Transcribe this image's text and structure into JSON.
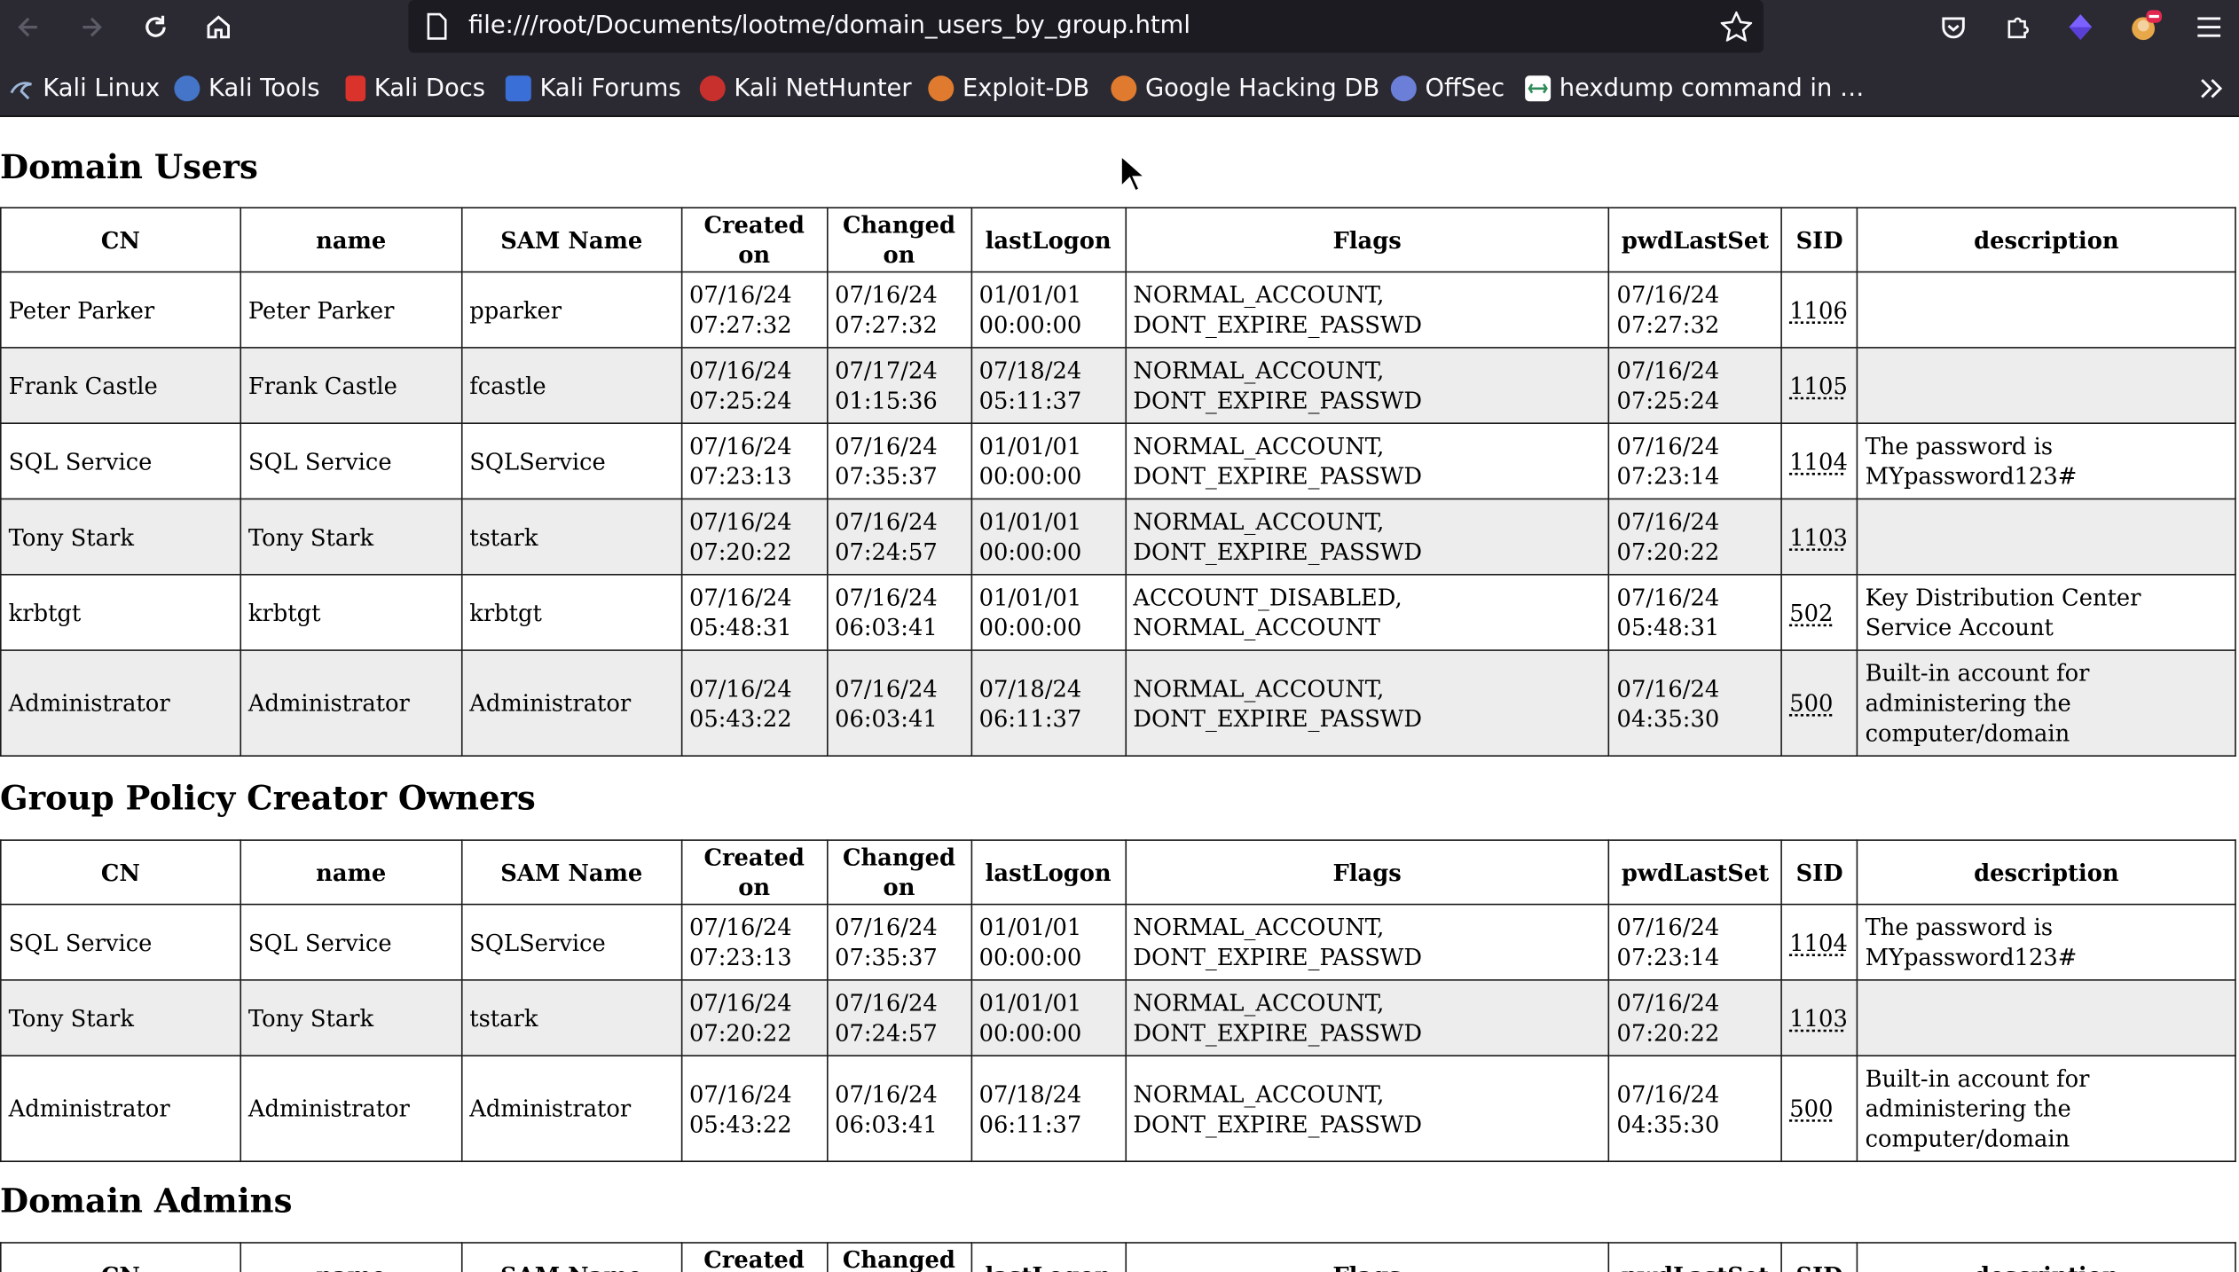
{
  "browser": {
    "url": "file:///root/Documents/lootme/domain_users_by_group.html",
    "bookmarks": [
      {
        "label": "Kali Linux",
        "icon": "kali-dragon-icon"
      },
      {
        "label": "Kali Tools",
        "icon": "kali-tools-icon"
      },
      {
        "label": "Kali Docs",
        "icon": "kali-docs-icon"
      },
      {
        "label": "Kali Forums",
        "icon": "kali-forums-icon"
      },
      {
        "label": "Kali NetHunter",
        "icon": "nethunter-icon"
      },
      {
        "label": "Exploit-DB",
        "icon": "exploit-db-icon"
      },
      {
        "label": "Google Hacking DB",
        "icon": "ghdb-icon"
      },
      {
        "label": "OffSec",
        "icon": "offsec-icon"
      },
      {
        "label": "hexdump command in …",
        "icon": "hexdump-icon"
      }
    ]
  },
  "headers": [
    "CN",
    "name",
    "SAM Name",
    "Created on",
    "Changed on",
    "lastLogon",
    "Flags",
    "pwdLastSet",
    "SID",
    "description"
  ],
  "sections": [
    {
      "title": "Domain Users",
      "rows": [
        {
          "cn": "Peter Parker",
          "name": "Peter Parker",
          "sam": "pparker",
          "created_date": "07/16/24",
          "created_time": "07:27:32",
          "changed_date": "07/16/24",
          "changed_time": "07:27:32",
          "logon_date": "01/01/01",
          "logon_time": "00:00:00",
          "flags1": "NORMAL_ACCOUNT,",
          "flags2": "DONT_EXPIRE_PASSWD",
          "pwd_date": "07/16/24",
          "pwd_time": "07:27:32",
          "sid": "1106",
          "desc1": "",
          "desc2": "",
          "desc3": ""
        },
        {
          "cn": "Frank Castle",
          "name": "Frank Castle",
          "sam": "fcastle",
          "created_date": "07/16/24",
          "created_time": "07:25:24",
          "changed_date": "07/17/24",
          "changed_time": "01:15:36",
          "logon_date": "07/18/24",
          "logon_time": "05:11:37",
          "flags1": "NORMAL_ACCOUNT,",
          "flags2": "DONT_EXPIRE_PASSWD",
          "pwd_date": "07/16/24",
          "pwd_time": "07:25:24",
          "sid": "1105",
          "desc1": "",
          "desc2": "",
          "desc3": ""
        },
        {
          "cn": "SQL Service",
          "name": "SQL Service",
          "sam": "SQLService",
          "created_date": "07/16/24",
          "created_time": "07:23:13",
          "changed_date": "07/16/24",
          "changed_time": "07:35:37",
          "logon_date": "01/01/01",
          "logon_time": "00:00:00",
          "flags1": "NORMAL_ACCOUNT,",
          "flags2": "DONT_EXPIRE_PASSWD",
          "pwd_date": "07/16/24",
          "pwd_time": "07:23:14",
          "sid": "1104",
          "desc1": "The password is",
          "desc2": "MYpassword123#",
          "desc3": ""
        },
        {
          "cn": "Tony Stark",
          "name": "Tony Stark",
          "sam": "tstark",
          "created_date": "07/16/24",
          "created_time": "07:20:22",
          "changed_date": "07/16/24",
          "changed_time": "07:24:57",
          "logon_date": "01/01/01",
          "logon_time": "00:00:00",
          "flags1": "NORMAL_ACCOUNT,",
          "flags2": "DONT_EXPIRE_PASSWD",
          "pwd_date": "07/16/24",
          "pwd_time": "07:20:22",
          "sid": "1103",
          "desc1": "",
          "desc2": "",
          "desc3": ""
        },
        {
          "cn": "krbtgt",
          "name": "krbtgt",
          "sam": "krbtgt",
          "created_date": "07/16/24",
          "created_time": "05:48:31",
          "changed_date": "07/16/24",
          "changed_time": "06:03:41",
          "logon_date": "01/01/01",
          "logon_time": "00:00:00",
          "flags1": "ACCOUNT_DISABLED,",
          "flags2": "NORMAL_ACCOUNT",
          "pwd_date": "07/16/24",
          "pwd_time": "05:48:31",
          "sid": "502",
          "desc1": "Key Distribution Center",
          "desc2": "Service Account",
          "desc3": ""
        },
        {
          "cn": "Administrator",
          "name": "Administrator",
          "sam": "Administrator",
          "created_date": "07/16/24",
          "created_time": "05:43:22",
          "changed_date": "07/16/24",
          "changed_time": "06:03:41",
          "logon_date": "07/18/24",
          "logon_time": "06:11:37",
          "flags1": "NORMAL_ACCOUNT,",
          "flags2": "DONT_EXPIRE_PASSWD",
          "pwd_date": "07/16/24",
          "pwd_time": "04:35:30",
          "sid": "500",
          "desc1": "Built-in account for",
          "desc2": "administering the",
          "desc3": "computer/domain"
        }
      ]
    },
    {
      "title": "Group Policy Creator Owners",
      "rows": [
        {
          "cn": "SQL Service",
          "name": "SQL Service",
          "sam": "SQLService",
          "created_date": "07/16/24",
          "created_time": "07:23:13",
          "changed_date": "07/16/24",
          "changed_time": "07:35:37",
          "logon_date": "01/01/01",
          "logon_time": "00:00:00",
          "flags1": "NORMAL_ACCOUNT,",
          "flags2": "DONT_EXPIRE_PASSWD",
          "pwd_date": "07/16/24",
          "pwd_time": "07:23:14",
          "sid": "1104",
          "desc1": "The password is",
          "desc2": "MYpassword123#",
          "desc3": ""
        },
        {
          "cn": "Tony Stark",
          "name": "Tony Stark",
          "sam": "tstark",
          "created_date": "07/16/24",
          "created_time": "07:20:22",
          "changed_date": "07/16/24",
          "changed_time": "07:24:57",
          "logon_date": "01/01/01",
          "logon_time": "00:00:00",
          "flags1": "NORMAL_ACCOUNT,",
          "flags2": "DONT_EXPIRE_PASSWD",
          "pwd_date": "07/16/24",
          "pwd_time": "07:20:22",
          "sid": "1103",
          "desc1": "",
          "desc2": "",
          "desc3": ""
        },
        {
          "cn": "Administrator",
          "name": "Administrator",
          "sam": "Administrator",
          "created_date": "07/16/24",
          "created_time": "05:43:22",
          "changed_date": "07/16/24",
          "changed_time": "06:03:41",
          "logon_date": "07/18/24",
          "logon_time": "06:11:37",
          "flags1": "NORMAL_ACCOUNT,",
          "flags2": "DONT_EXPIRE_PASSWD",
          "pwd_date": "07/16/24",
          "pwd_time": "04:35:30",
          "sid": "500",
          "desc1": "Built-in account for",
          "desc2": "administering the",
          "desc3": "computer/domain"
        }
      ]
    },
    {
      "title": "Domain Admins",
      "rows": []
    }
  ]
}
